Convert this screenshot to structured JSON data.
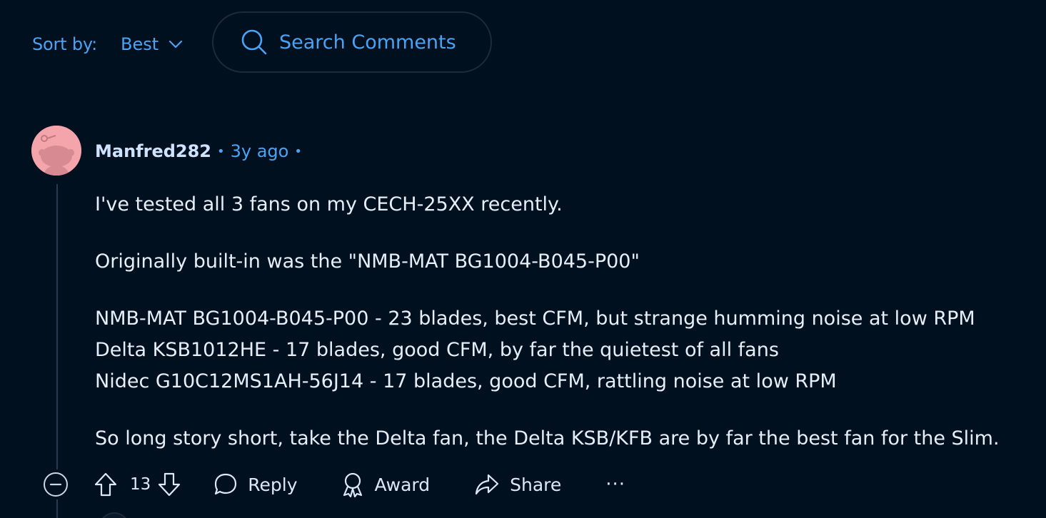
{
  "toolbar": {
    "sort_label": "Sort by:",
    "sort_value": "Best",
    "search_placeholder": "Search Comments"
  },
  "comment": {
    "author": "Manfred282",
    "time": "3y ago",
    "body": {
      "line1": "I've tested all 3 fans on my CECH-25XX recently.",
      "line2": "Originally built-in was the \"NMB-MAT BG1004-B045-P00\"",
      "line3": "NMB-MAT BG1004-B045-P00 - 23 blades, best CFM, but strange humming noise at low RPM",
      "line4": "Delta KSB1012HE - 17 blades, good CFM, by far the quietest of all fans",
      "line5": "Nidec G10C12MS1AH-56J14 - 17 blades, good CFM, rattling noise at low RPM",
      "line6": "So long story short, take the Delta fan, the Delta KSB/KFB are by far the best fan for the Slim."
    },
    "vote_count": "13",
    "actions": {
      "reply": "Reply",
      "award": "Award",
      "share": "Share",
      "more": "···"
    }
  },
  "colors": {
    "background": "#01101f",
    "accent": "#4aa3f5",
    "avatar_bg": "#f4a5ac"
  }
}
